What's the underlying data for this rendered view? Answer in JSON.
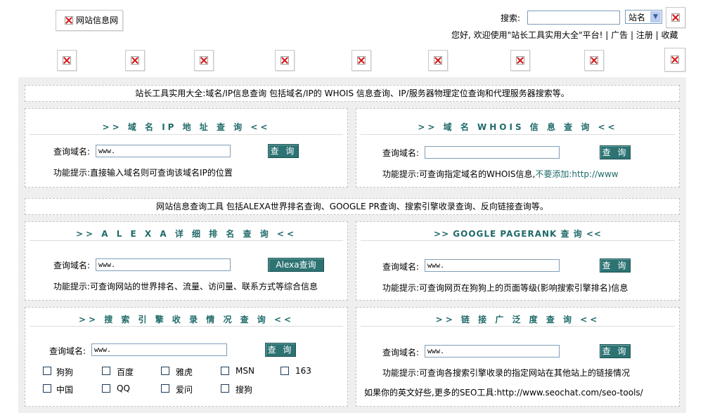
{
  "header": {
    "logo_text": "网站信息网",
    "search_label": "搜索:",
    "search_value": "",
    "search_select": "站名",
    "welcome": "您好, 欢迎使用\"站长工具实用大全\"平台! | 广告 | 注册 | 收藏"
  },
  "intro1": "站长工具实用大全:域名/IP信息查询 包括域名/IP的 WHOIS 信息查询、IP/服务器物理定位查询和代理服务器搜索等。",
  "intro2": "网站信息查询工具 包括ALEXA世界排名查询、GOOGLE PR查询、搜索引擎收录查询、反向链接查询等。",
  "panels": {
    "ip": {
      "title": ">> 域 名 IP 地 址 查 询 <<",
      "label": "查询域名:",
      "value": "www.",
      "button": "查 询",
      "hint": "功能提示:直接输入域名则可查询该域名IP的位置"
    },
    "whois": {
      "title": ">> 域 名 WHOIS 信 息 查 询 <<",
      "label": "查询域名:",
      "value": "",
      "button": "查 询",
      "hint": "功能提示:可查询指定域名的WHOIS信息,",
      "hint_extra": "不要添加:http://www"
    },
    "alexa": {
      "title": ">> A L E X A 详 细 排 名 查 询 <<",
      "label": "查询域名:",
      "value": "www.",
      "button": "Alexa查询",
      "hint": "功能提示:可查询网站的世界排名、流量、访问量、联系方式等综合信息"
    },
    "pr": {
      "title": ">> GOOGLE PAGERANK 查 询 <<",
      "label": "查询域名:",
      "value": "www.",
      "button": "查 询",
      "hint": "功能提示:可查询网页在狗狗上的页面等级(影响搜索引擎排名)信息"
    },
    "engine": {
      "title": ">> 搜 索 引 擎 收 录 情 况 查 询 <<",
      "label": "查询域名:",
      "value": "www.",
      "button": "查 询",
      "checks": [
        "狗狗",
        "百度",
        "雅虎",
        "MSN",
        "163",
        "中国",
        "QQ",
        "爱问",
        "搜狗"
      ]
    },
    "links": {
      "title": ">> 链 接 广 泛 度 查 询 <<",
      "label": "查询域名:",
      "value": "www.",
      "button": "查 询",
      "hint": "功能提示:可查询各搜索引擎收录的指定网站在其他站上的链接情况",
      "more": "如果你的英文好些,更多的SEO工具:http://www.seochat.com/seo-tools/"
    }
  }
}
